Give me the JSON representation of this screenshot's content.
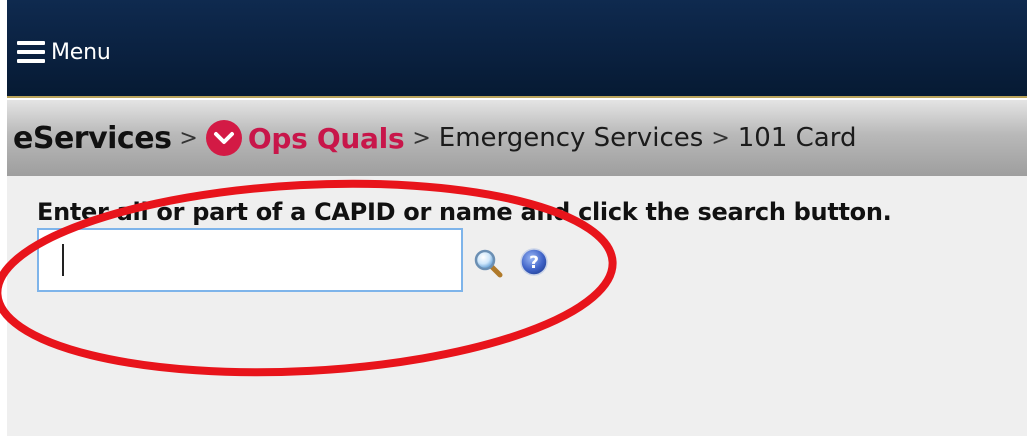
{
  "header": {
    "menu_label": "Menu",
    "menu_icon": "hamburger-icon"
  },
  "breadcrumb": {
    "root": "eServices",
    "separator": ">",
    "active": "Ops Quals",
    "active_icon": "chevron-down-circle-icon",
    "items": [
      "Emergency Services",
      "101 Card"
    ]
  },
  "search": {
    "instruction": "Enter all or part of a CAPID or name and click the search button.",
    "value": "",
    "search_icon": "magnifier-icon",
    "help_icon": "help-icon"
  },
  "colors": {
    "header_bg": "#0a2140",
    "accent_red": "#c8164a",
    "input_border": "#7eb4ea",
    "annotation_red": "#e8141b"
  }
}
